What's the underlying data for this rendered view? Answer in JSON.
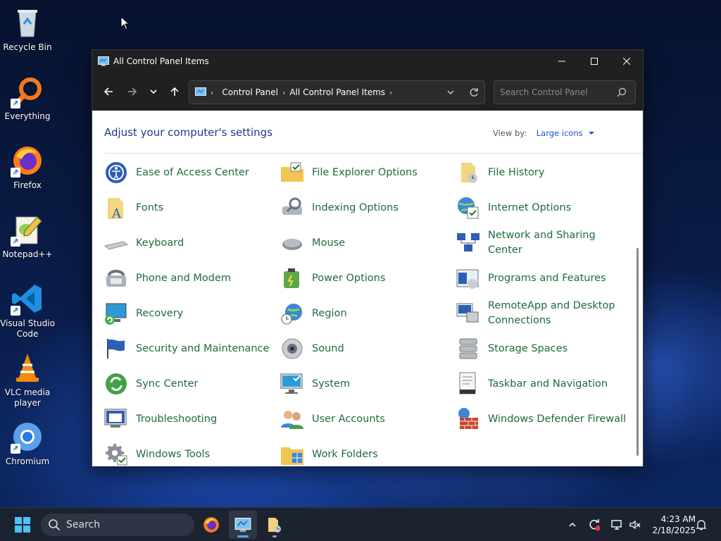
{
  "desktop": {
    "icons": [
      {
        "label": "Recycle Bin",
        "icon": "recycle-bin-icon"
      },
      {
        "label": "Everything",
        "icon": "everything-search-icon"
      },
      {
        "label": "Firefox",
        "icon": "firefox-icon"
      },
      {
        "label": "Notepad++",
        "icon": "notepad-plus-plus-icon"
      },
      {
        "label": "Visual Studio Code",
        "icon": "vscode-icon"
      },
      {
        "label": "VLC media player",
        "icon": "vlc-icon"
      },
      {
        "label": "Chromium",
        "icon": "chromium-icon"
      }
    ]
  },
  "window": {
    "title": "All Control Panel Items",
    "breadcrumb": [
      "Control Panel",
      "All Control Panel Items"
    ],
    "search_placeholder": "Search Control Panel",
    "heading": "Adjust your computer's settings",
    "view_by_label": "View by:",
    "view_by_value": "Large icons",
    "items": [
      {
        "label": "Ease of Access Center",
        "icon": "ease-of-access-icon"
      },
      {
        "label": "File Explorer Options",
        "icon": "file-explorer-options-icon"
      },
      {
        "label": "File History",
        "icon": "file-history-icon"
      },
      {
        "label": "Fonts",
        "icon": "fonts-icon"
      },
      {
        "label": "Indexing Options",
        "icon": "indexing-options-icon"
      },
      {
        "label": "Internet Options",
        "icon": "internet-options-icon"
      },
      {
        "label": "Keyboard",
        "icon": "keyboard-icon"
      },
      {
        "label": "Mouse",
        "icon": "mouse-icon"
      },
      {
        "label": "Network and Sharing Center",
        "icon": "network-sharing-icon"
      },
      {
        "label": "Phone and Modem",
        "icon": "phone-modem-icon"
      },
      {
        "label": "Power Options",
        "icon": "power-options-icon"
      },
      {
        "label": "Programs and Features",
        "icon": "programs-features-icon"
      },
      {
        "label": "Recovery",
        "icon": "recovery-icon"
      },
      {
        "label": "Region",
        "icon": "region-icon"
      },
      {
        "label": "RemoteApp and Desktop Connections",
        "icon": "remoteapp-icon"
      },
      {
        "label": "Security and Maintenance",
        "icon": "security-maintenance-icon"
      },
      {
        "label": "Sound",
        "icon": "sound-icon"
      },
      {
        "label": "Storage Spaces",
        "icon": "storage-spaces-icon"
      },
      {
        "label": "Sync Center",
        "icon": "sync-center-icon"
      },
      {
        "label": "System",
        "icon": "system-icon"
      },
      {
        "label": "Taskbar and Navigation",
        "icon": "taskbar-navigation-icon"
      },
      {
        "label": "Troubleshooting",
        "icon": "troubleshooting-icon"
      },
      {
        "label": "User Accounts",
        "icon": "user-accounts-icon"
      },
      {
        "label": "Windows Defender Firewall",
        "icon": "firewall-icon"
      },
      {
        "label": "Windows Tools",
        "icon": "windows-tools-icon"
      },
      {
        "label": "Work Folders",
        "icon": "work-folders-icon"
      }
    ]
  },
  "taskbar": {
    "search_label": "Search",
    "time": "4:23 AM",
    "date": "2/18/2025"
  },
  "colors": {
    "link_green": "#1e6b3a",
    "heading_blue": "#1e3a8a",
    "accent_blue": "#60a5fa"
  }
}
